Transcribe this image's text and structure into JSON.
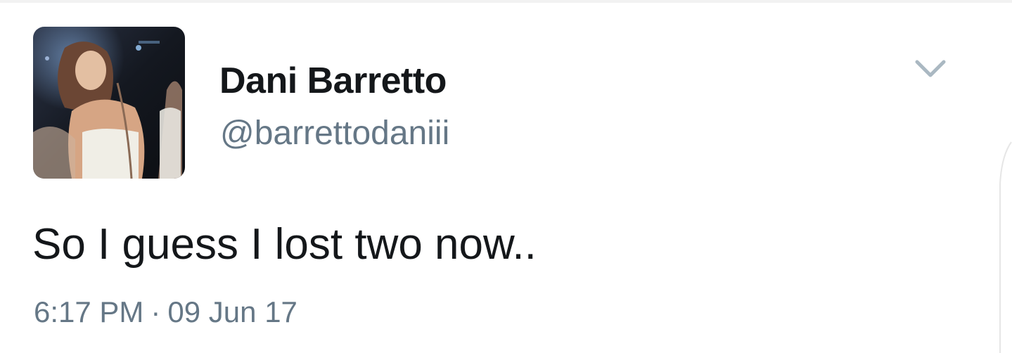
{
  "tweet": {
    "display_name": "Dani Barretto",
    "handle": "@barrettodaniii",
    "text": "So I guess I lost two now..",
    "time": "6:17 PM",
    "separator": "·",
    "date": "09 Jun 17",
    "avatar": "profile-photo",
    "menu_icon": "chevron-down-icon"
  },
  "colors": {
    "name": "#14171a",
    "secondary": "#657786",
    "caret": "#aab8c2",
    "background": "#ffffff"
  }
}
